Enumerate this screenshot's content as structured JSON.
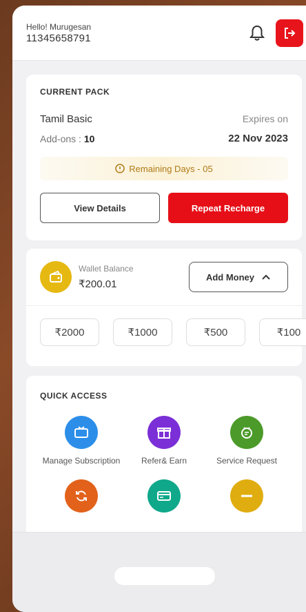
{
  "header": {
    "greeting": "Hello! Murugesan",
    "account_number": "11345658791"
  },
  "current_pack": {
    "section_title": "CURRENT PACK",
    "pack_name": "Tamil Basic",
    "addons_label": "Add-ons :",
    "addons_count": "10",
    "expires_label": "Expires on",
    "expires_date": "22 Nov 2023",
    "remaining_text": "Remaining Days - 05",
    "view_details_label": "View Details",
    "repeat_recharge_label": "Repeat Recharge"
  },
  "wallet": {
    "label": "Wallet Balance",
    "balance": "₹200.01",
    "add_money_label": "Add Money",
    "amounts": [
      "₹2000",
      "₹1000",
      "₹500",
      "₹100"
    ]
  },
  "quick_access": {
    "section_title": "QUICK ACCESS",
    "items": [
      {
        "label": "Manage Subscription",
        "color": "#2c8ee8",
        "icon": "tv-icon"
      },
      {
        "label": "Refer& Earn",
        "color": "#7b2fd6",
        "icon": "gift-icon"
      },
      {
        "label": "Service Request",
        "color": "#4c9a2a",
        "icon": "support-icon"
      },
      {
        "label": "",
        "color": "#e2621b",
        "icon": "refresh-icon"
      },
      {
        "label": "",
        "color": "#0fa88a",
        "icon": "card-icon"
      },
      {
        "label": "",
        "color": "#e0ad10",
        "icon": "minus-icon"
      }
    ]
  },
  "colors": {
    "accent_red": "#e60f17",
    "wallet_yellow": "#e6b912"
  }
}
